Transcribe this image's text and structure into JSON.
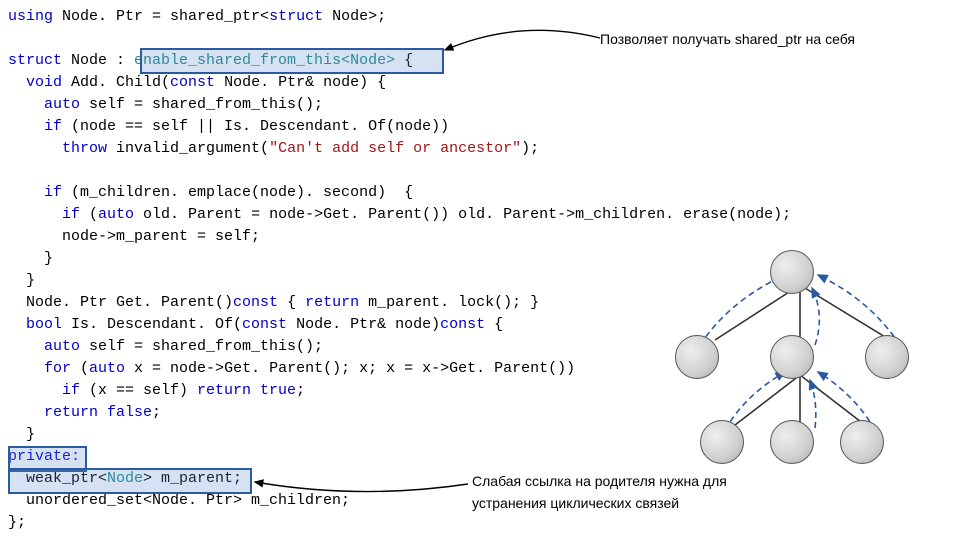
{
  "code": {
    "l1a": "using",
    "l1b": " Node. Ptr = shared_ptr<",
    "l1c": "struct",
    "l1d": " Node>;",
    "l2a": "struct",
    "l2b": " Node : ",
    "l2c": "enable_shared_from_this",
    "l2d": "<Node>",
    "l2e": " {",
    "l3a": "  void",
    "l3b": " Add. Child(",
    "l3c": "const",
    "l3d": " Node. Ptr& node) {",
    "l4a": "    auto",
    "l4b": " self = shared_from_this();",
    "l5a": "    if",
    "l5b": " (node == self || Is. Descendant. Of(node))",
    "l6a": "      throw",
    "l6b": " invalid_argument(",
    "l6c": "\"Can't add self or ancestor\"",
    "l6d": ");",
    "l7": "",
    "l8a": "    if",
    "l8b": " (m_children. emplace(node). second)  {",
    "l9a": "      if",
    "l9b": " (",
    "l9c": "auto",
    "l9d": " old. Parent = node->Get. Parent()) old. Parent->m_children. erase(node);",
    "l10": "      node->m_parent = self;",
    "l11": "    }",
    "l12": "  }",
    "l13a": "  Node. Ptr Get. Parent()",
    "l13b": "const",
    "l13c": " { ",
    "l13d": "return",
    "l13e": " m_parent. lock(); }",
    "l14a": "  bool",
    "l14b": " Is. Descendant. Of(",
    "l14c": "const",
    "l14d": " Node. Ptr& node)",
    "l14e": "const",
    "l14f": " {",
    "l15a": "    auto",
    "l15b": " self = shared_from_this();",
    "l16a": "    for",
    "l16b": " (",
    "l16c": "auto",
    "l16d": " x = node->Get. Parent(); x; x = x->Get. Parent())",
    "l17a": "      if",
    "l17b": " (x == self) ",
    "l17c": "return true",
    "l17d": ";",
    "l18a": "    return false",
    "l18b": ";",
    "l19": "  }",
    "l20": "private:",
    "l21a": "  weak_ptr<",
    "l21b": "Node",
    "l21c": "> m_parent;",
    "l22": "  unordered_set<Node. Ptr> m_children;",
    "l23": "};"
  },
  "annotations": {
    "a1": "Позволяет получать shared_ptr на себя",
    "a2": "Слабая ссылка на родителя нужна для\nустранения циклических связей"
  }
}
